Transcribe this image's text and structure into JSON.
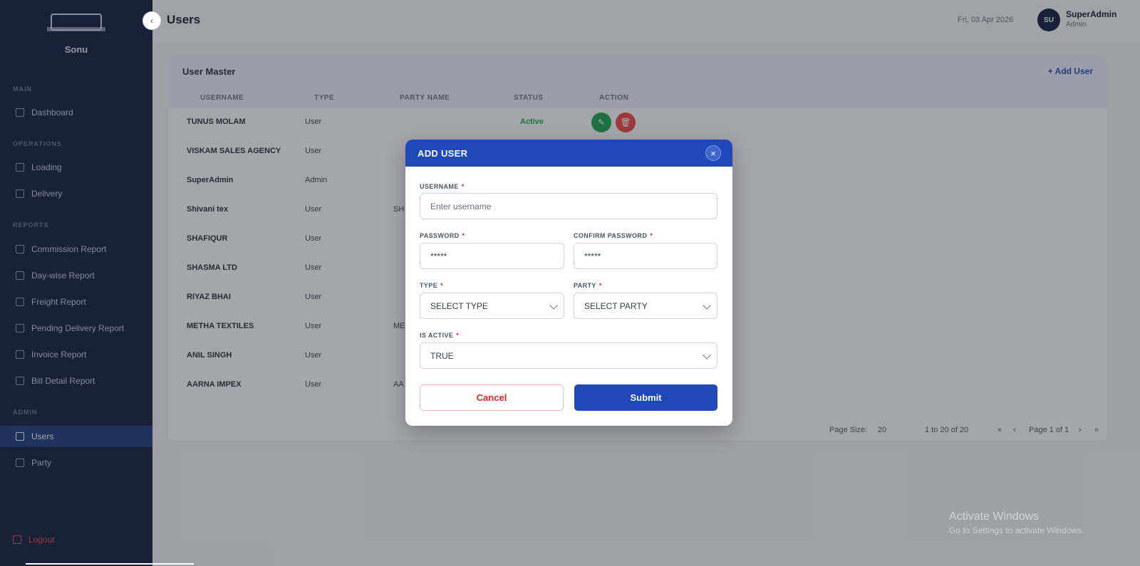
{
  "sidebar": {
    "brand": "Sonu",
    "sections": [
      "MAIN",
      "OPERATIONS",
      "REPORTS",
      "ADMIN"
    ],
    "items": [
      {
        "label": "Dashboard",
        "icon": "grid-icon"
      },
      {
        "label": "Loading",
        "icon": "truck-icon"
      },
      {
        "label": "Delivery",
        "icon": "clock-icon"
      },
      {
        "label": "Commission Report",
        "icon": "report-icon"
      },
      {
        "label": "Day-wise Report",
        "icon": "calendar-icon"
      },
      {
        "label": "Freight Report",
        "icon": "freight-icon"
      },
      {
        "label": "Pending Delivery Report",
        "icon": "pending-icon"
      },
      {
        "label": "Invoice Report",
        "icon": "invoice-icon"
      },
      {
        "label": "Bill Detail Report",
        "icon": "bill-icon"
      },
      {
        "label": "Users",
        "icon": "users-icon",
        "active": true
      },
      {
        "label": "Party",
        "icon": "party-icon"
      }
    ],
    "logout": "Logout"
  },
  "header": {
    "title": "Users",
    "date": "Fri, 03 Apr 2026",
    "avatar": "SU",
    "user_name": "SuperAdmin",
    "user_role": "Admin"
  },
  "card": {
    "title": "User Master",
    "add_link": "+ Add User",
    "columns": [
      "USERNAME",
      "TYPE",
      "PARTY NAME",
      "STATUS",
      "ACTION"
    ],
    "rows": [
      {
        "username": "TUNUS MOLAM",
        "type": "User",
        "party": "",
        "status": "Active"
      },
      {
        "username": "VISKAM SALES AGENCY",
        "type": "User",
        "party": "",
        "status": ""
      },
      {
        "username": "SuperAdmin",
        "type": "Admin",
        "party": "",
        "status": ""
      },
      {
        "username": "Shivani tex",
        "type": "User",
        "party": "SH",
        "status": ""
      },
      {
        "username": "SHAFIQUR",
        "type": "User",
        "party": "",
        "status": ""
      },
      {
        "username": "SHASMA LTD",
        "type": "User",
        "party": "",
        "status": ""
      },
      {
        "username": "RIYAZ BHAI",
        "type": "User",
        "party": "",
        "status": ""
      },
      {
        "username": "METHA TEXTILES",
        "type": "User",
        "party": "ME",
        "status": ""
      },
      {
        "username": "ANIL SINGH",
        "type": "User",
        "party": "",
        "status": ""
      },
      {
        "username": "AARNA IMPEX",
        "type": "User",
        "party": "AA",
        "status": ""
      }
    ],
    "pager": {
      "page_size_label": "Page Size:",
      "page_size": "20",
      "range": "1 to 20 of 20",
      "page_label": "Page 1 of 1"
    }
  },
  "modal": {
    "title": "ADD USER",
    "close_icon": "×",
    "username_label": "USERNAME",
    "username_placeholder": "Enter username",
    "password_label": "PASSWORD",
    "password_value": "*****",
    "confirm_label": "CONFIRM PASSWORD",
    "confirm_value": "*****",
    "type_label": "TYPE",
    "type_value": "SELECT TYPE",
    "party_label": "PARTY",
    "party_value": "SELECT PARTY",
    "active_label": "IS ACTIVE",
    "active_value": "TRUE",
    "required_mark": "*",
    "cancel": "Cancel",
    "submit": "Submit"
  },
  "watermark": {
    "line1": "Activate Windows",
    "line2": "Go to Settings to activate Windows."
  },
  "colors": {
    "sidebar_bg": "#0f1b3d",
    "primary": "#1f48b8",
    "danger": "#dc2626",
    "success": "#16a34a"
  }
}
